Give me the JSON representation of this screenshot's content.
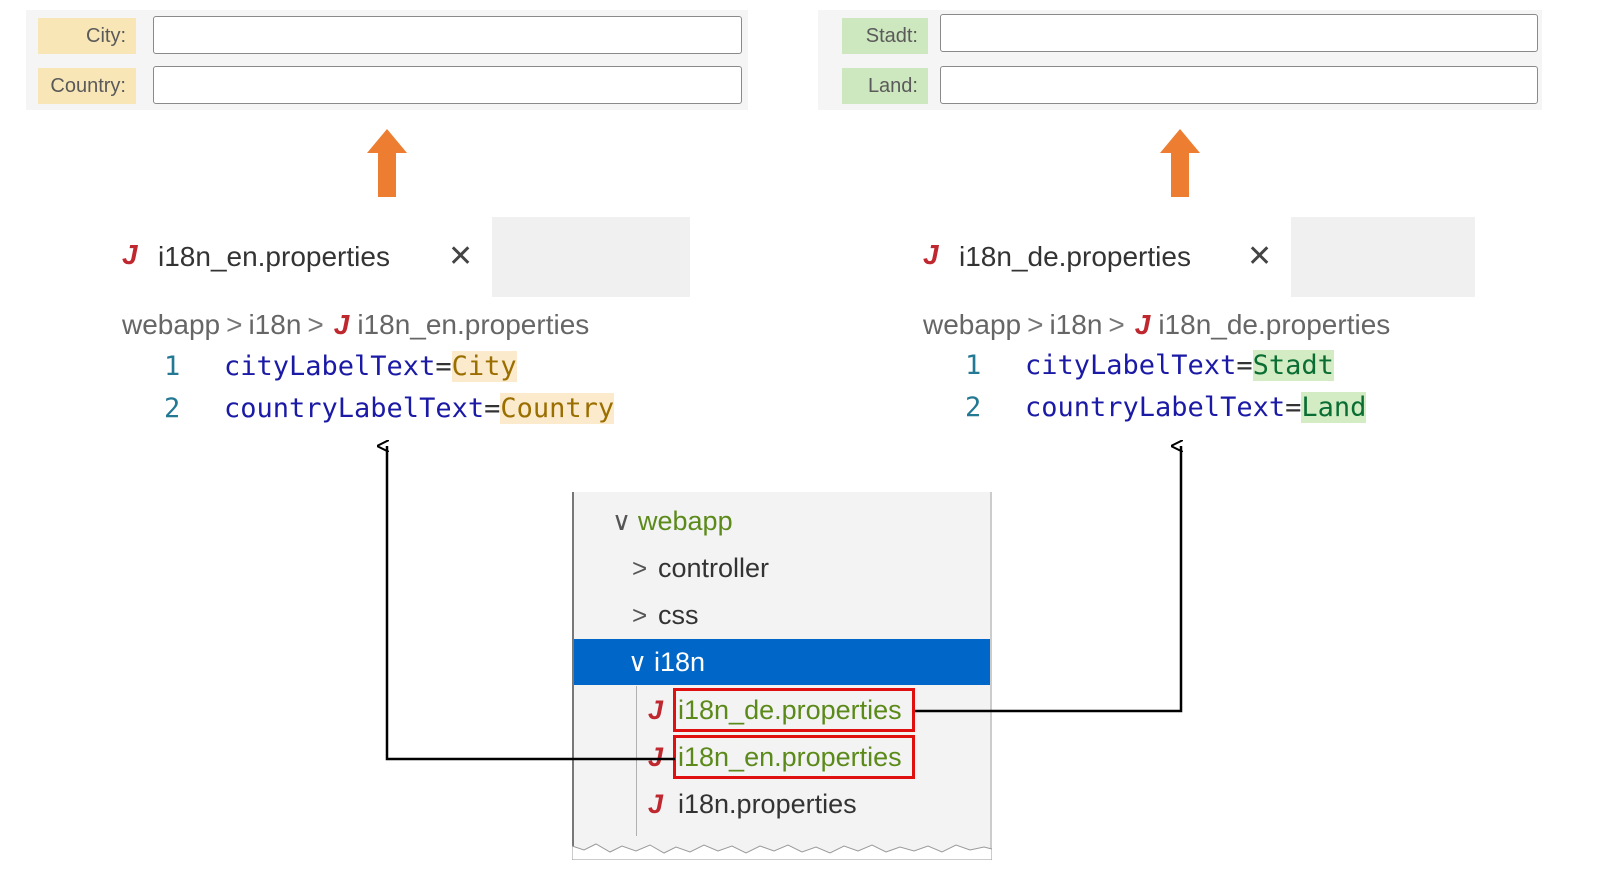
{
  "form_en": {
    "city_label": "City:",
    "country_label": "Country:"
  },
  "form_de": {
    "city_label": "Stadt:",
    "country_label": "Land:"
  },
  "editor_en": {
    "tab_title": "i18n_en.properties",
    "close_glyph": "✕",
    "icon_glyph": "J",
    "breadcrumb": [
      "webapp",
      "i18n",
      "i18n_en.properties"
    ],
    "lines": [
      {
        "number": "1",
        "key": "cityLabelText",
        "eq": "=",
        "value": "City"
      },
      {
        "number": "2",
        "key": "countryLabelText",
        "eq": "=",
        "value": "Country"
      }
    ]
  },
  "editor_de": {
    "tab_title": "i18n_de.properties",
    "close_glyph": "✕",
    "icon_glyph": "J",
    "breadcrumb": [
      "webapp",
      "i18n",
      "i18n_de.properties"
    ],
    "lines": [
      {
        "number": "1",
        "key": "cityLabelText",
        "eq": "=",
        "value": "Stadt"
      },
      {
        "number": "2",
        "key": "countryLabelText",
        "eq": "=",
        "value": "Land"
      }
    ]
  },
  "explorer": {
    "items": [
      {
        "label": "webapp",
        "chevron": "∨"
      },
      {
        "label": "controller",
        "chevron": ">"
      },
      {
        "label": "css",
        "chevron": ">"
      },
      {
        "label": "i18n",
        "chevron": "∨"
      },
      {
        "label": "i18n_de.properties",
        "icon": "J"
      },
      {
        "label": "i18n_en.properties",
        "icon": "J"
      },
      {
        "label": "i18n.properties",
        "icon": "J"
      }
    ]
  },
  "colors": {
    "english_highlight": "#f9e6b6",
    "german_highlight": "#cde7be",
    "arrow_orange": "#ed7d31",
    "selection_blue": "#0066c8",
    "highlight_box_red": "#e01010"
  },
  "icons": {
    "tab_icon": "java-properties-icon",
    "close": "close-icon",
    "chevron_right": "chevron-right-icon",
    "chevron_down": "chevron-down-icon"
  }
}
